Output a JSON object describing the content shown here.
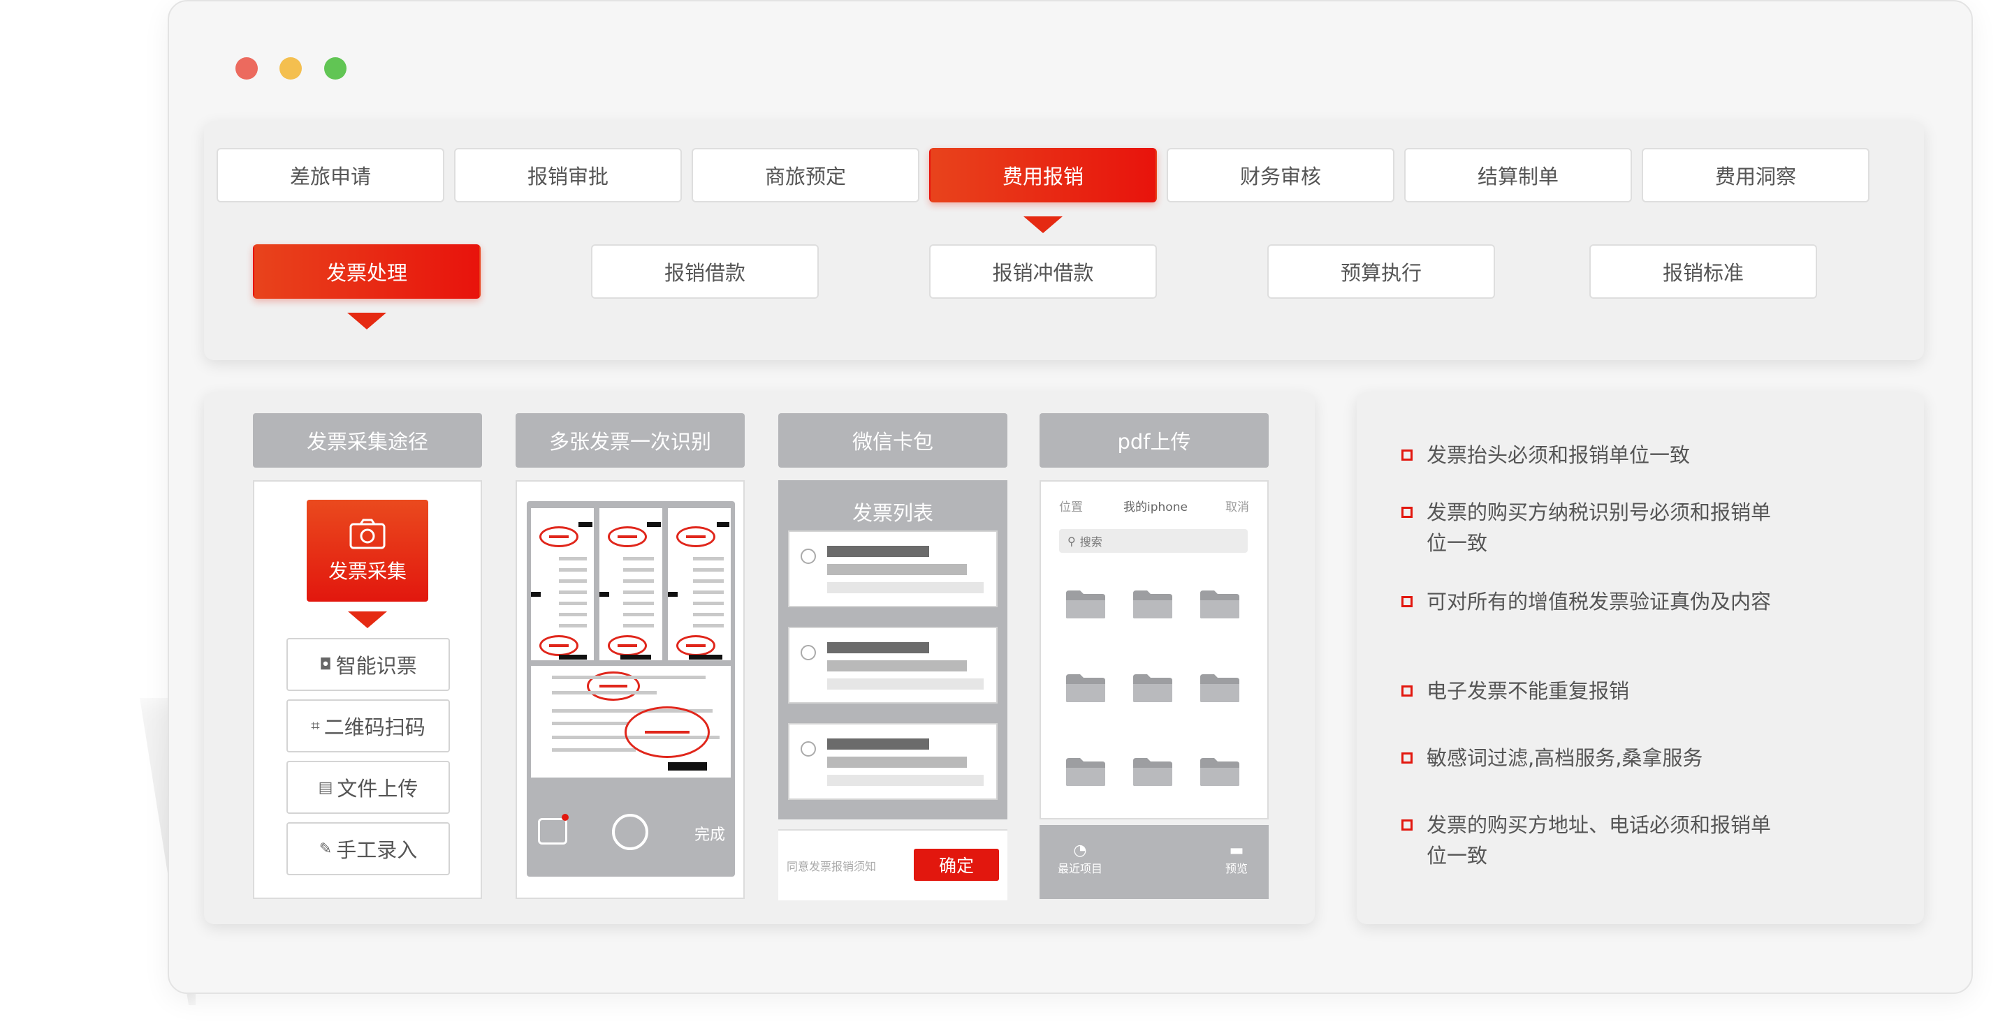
{
  "window": {
    "dots": [
      "close",
      "minimize",
      "maximize"
    ]
  },
  "colors": {
    "accent": "#e2170e",
    "gray_header": "#b4b5b8",
    "panel": "#f0f0f0"
  },
  "main_tabs": [
    {
      "label": "差旅申请"
    },
    {
      "label": "报销审批"
    },
    {
      "label": "商旅预定"
    },
    {
      "label": "费用报销",
      "active": true
    },
    {
      "label": "财务审核"
    },
    {
      "label": "结算制单"
    },
    {
      "label": "费用洞察"
    }
  ],
  "sub_tabs": [
    {
      "label": "发票处理",
      "active": true
    },
    {
      "label": "报销借款"
    },
    {
      "label": "报销冲借款"
    },
    {
      "label": "预算执行"
    },
    {
      "label": "报销标准"
    }
  ],
  "columns": {
    "collect": {
      "title": "发票采集途径",
      "capture_label": "发票采集",
      "methods": [
        {
          "icon": "camera-icon",
          "label": "智能识票"
        },
        {
          "icon": "scan-icon",
          "label": "二维码扫码"
        },
        {
          "icon": "document-icon",
          "label": "文件上传"
        },
        {
          "icon": "pen-icon",
          "label": "手工录入"
        }
      ]
    },
    "multi": {
      "title": "多张发票一次识别",
      "done_label": "完成"
    },
    "wechat": {
      "title": "微信卡包",
      "list_title": "发票列表",
      "footer_note": "同意发票报销须知",
      "confirm_label": "确定"
    },
    "pdf": {
      "title": "pdf上传",
      "nav_left": "位置",
      "nav_center": "我的iphone",
      "nav_right": "取消",
      "search_placeholder": "搜索",
      "footer_left": "最近项目",
      "footer_right": "预览"
    }
  },
  "rules": [
    "发票抬头必须和报销单位一致",
    "发票的购买方纳税识别号必须和报销单位一致",
    "可对所有的增值税发票验证真伪及内容",
    "电子发票不能重复报销",
    "敏感词过滤,高档服务,桑拿服务",
    "发票的购买方地址、电话必须和报销单位一致"
  ]
}
